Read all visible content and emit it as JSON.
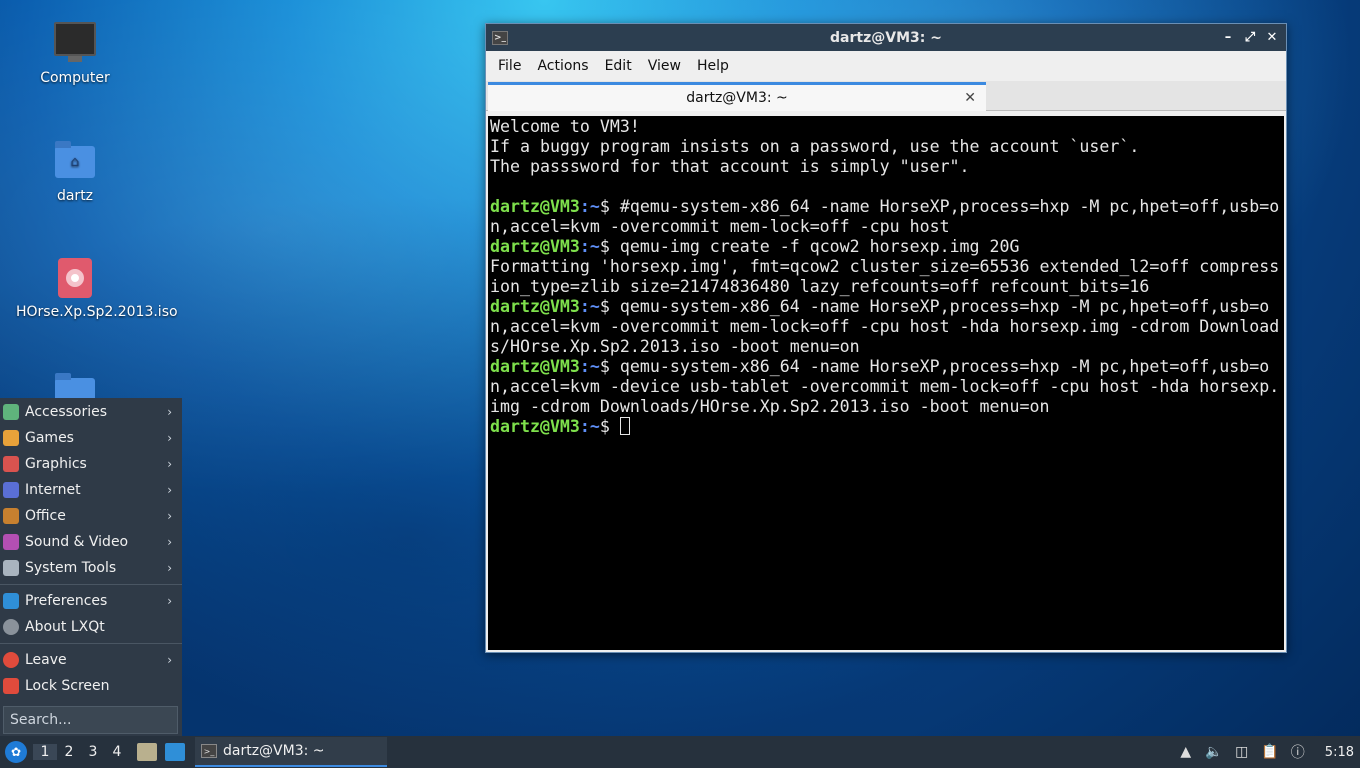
{
  "desktop": {
    "icons": [
      {
        "label": "Computer",
        "icon": "monitor-icon"
      },
      {
        "label": "dartz",
        "icon": "home-folder-icon"
      },
      {
        "label": "HOrse.Xp.Sp2.2013.iso",
        "icon": "disc-image-icon"
      }
    ]
  },
  "window": {
    "title": "dartz@VM3: ~",
    "menus": [
      "File",
      "Actions",
      "Edit",
      "View",
      "Help"
    ],
    "tab_label": "dartz@VM3: ~",
    "colors": {
      "prompt_user": "#7ee04c",
      "prompt_path": "#5f8ff6",
      "accent": "#3c8ae0"
    }
  },
  "terminal": {
    "intro": [
      "Welcome to VM3!",
      "If a buggy program insists on a password, use the account `user`.",
      "The passsword for that account is simply \"user\"."
    ],
    "prompt_user": "dartz@VM3",
    "prompt_path": ":~",
    "prompt_symbol": "$ ",
    "commands": [
      {
        "cmd": "#qemu-system-x86_64 -name HorseXP,process=hxp -M pc,hpet=off,usb=on,accel=kvm -overcommit mem-lock=off -cpu host",
        "output": ""
      },
      {
        "cmd": "qemu-img create -f qcow2 horsexp.img 20G",
        "output": "Formatting 'horsexp.img', fmt=qcow2 cluster_size=65536 extended_l2=off compression_type=zlib size=21474836480 lazy_refcounts=off refcount_bits=16"
      },
      {
        "cmd": "qemu-system-x86_64 -name HorseXP,process=hxp -M pc,hpet=off,usb=on,accel=kvm -overcommit mem-lock=off -cpu host -hda horsexp.img -cdrom Downloads/HOrse.Xp.Sp2.2013.iso -boot menu=on",
        "output": ""
      },
      {
        "cmd": "qemu-system-x86_64 -name HorseXP,process=hxp -M pc,hpet=off,usb=on,accel=kvm -device usb-tablet -overcommit mem-lock=off -cpu host -hda horsexp.img -cdrom Downloads/HOrse.Xp.Sp2.2013.iso -boot menu=on",
        "output": ""
      }
    ]
  },
  "startmenu": {
    "categories": [
      {
        "label": "Accessories",
        "color": "#5fb37c"
      },
      {
        "label": "Games",
        "color": "#e8a23a"
      },
      {
        "label": "Graphics",
        "color": "#d9534f"
      },
      {
        "label": "Internet",
        "color": "#5a6fd6"
      },
      {
        "label": "Office",
        "color": "#c7802f"
      },
      {
        "label": "Sound & Video",
        "color": "#b34fb3"
      },
      {
        "label": "System Tools",
        "color": "#a9b4bf"
      }
    ],
    "preferences": "Preferences",
    "about": "About LXQt",
    "leave": "Leave",
    "lock": "Lock Screen",
    "search_placeholder": "Search..."
  },
  "taskbar": {
    "workspaces": [
      "1",
      "2",
      "3",
      "4"
    ],
    "active_workspace": "1",
    "task_label": "dartz@VM3: ~",
    "clock": "5:18"
  }
}
